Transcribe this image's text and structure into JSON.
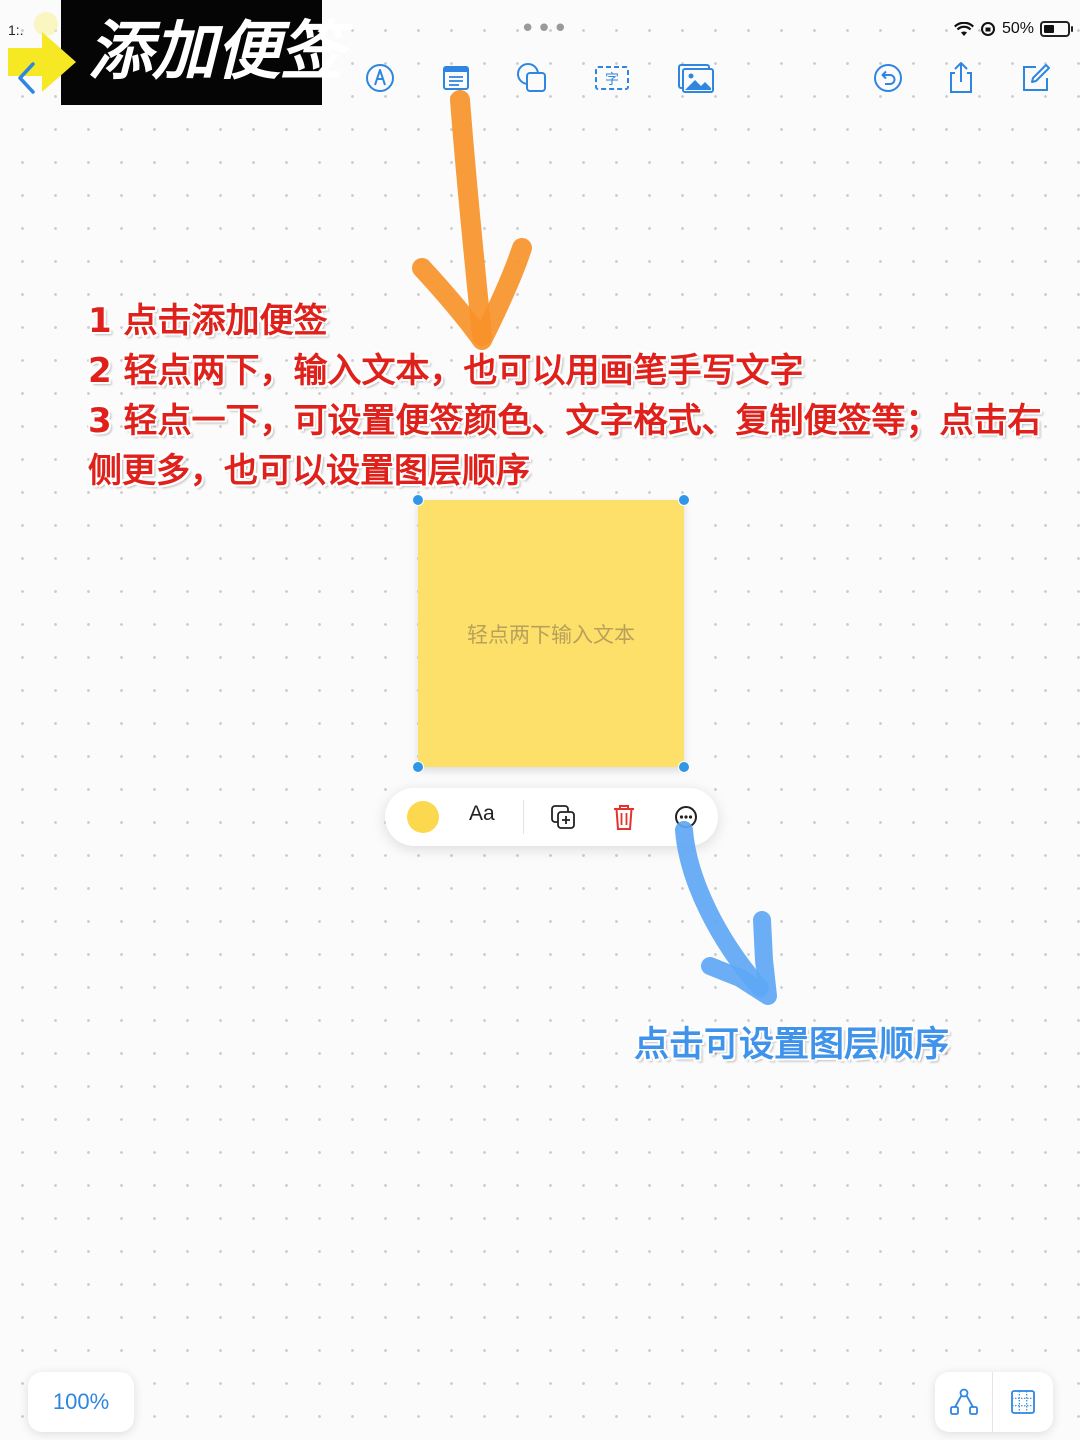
{
  "status_bar": {
    "time": "1:.",
    "battery": "50%"
  },
  "title": "添加便签",
  "toolbar": {
    "icons": [
      "pen-icon",
      "sticky-note-icon",
      "shapes-icon",
      "text-box-icon",
      "image-icon",
      "undo-icon",
      "share-icon",
      "compose-icon"
    ]
  },
  "instructions": {
    "line1": "1 点击添加便签",
    "line2": "2 轻点两下，输入文本，也可以用画笔手写文字",
    "line3": "3 轻点一下，可设置便签颜色、文字格式、复制便签等；点击右",
    "line4": "侧更多，也可以设置图层顺序"
  },
  "sticky_note": {
    "placeholder": "轻点两下输入文本",
    "color": "#fde06a"
  },
  "context_menu": {
    "font_label": "Aa",
    "swatch_color": "#fcd84f"
  },
  "layer_annotation": "点击可设置图层顺序",
  "zoom": {
    "label": "100%"
  },
  "colors": {
    "accent": "#2f86e0",
    "instruction_red": "#e0211b",
    "annotation_blue": "#3f93ea",
    "arrow_orange": "#f7922a",
    "arrow_blue": "#5ea7f5"
  }
}
